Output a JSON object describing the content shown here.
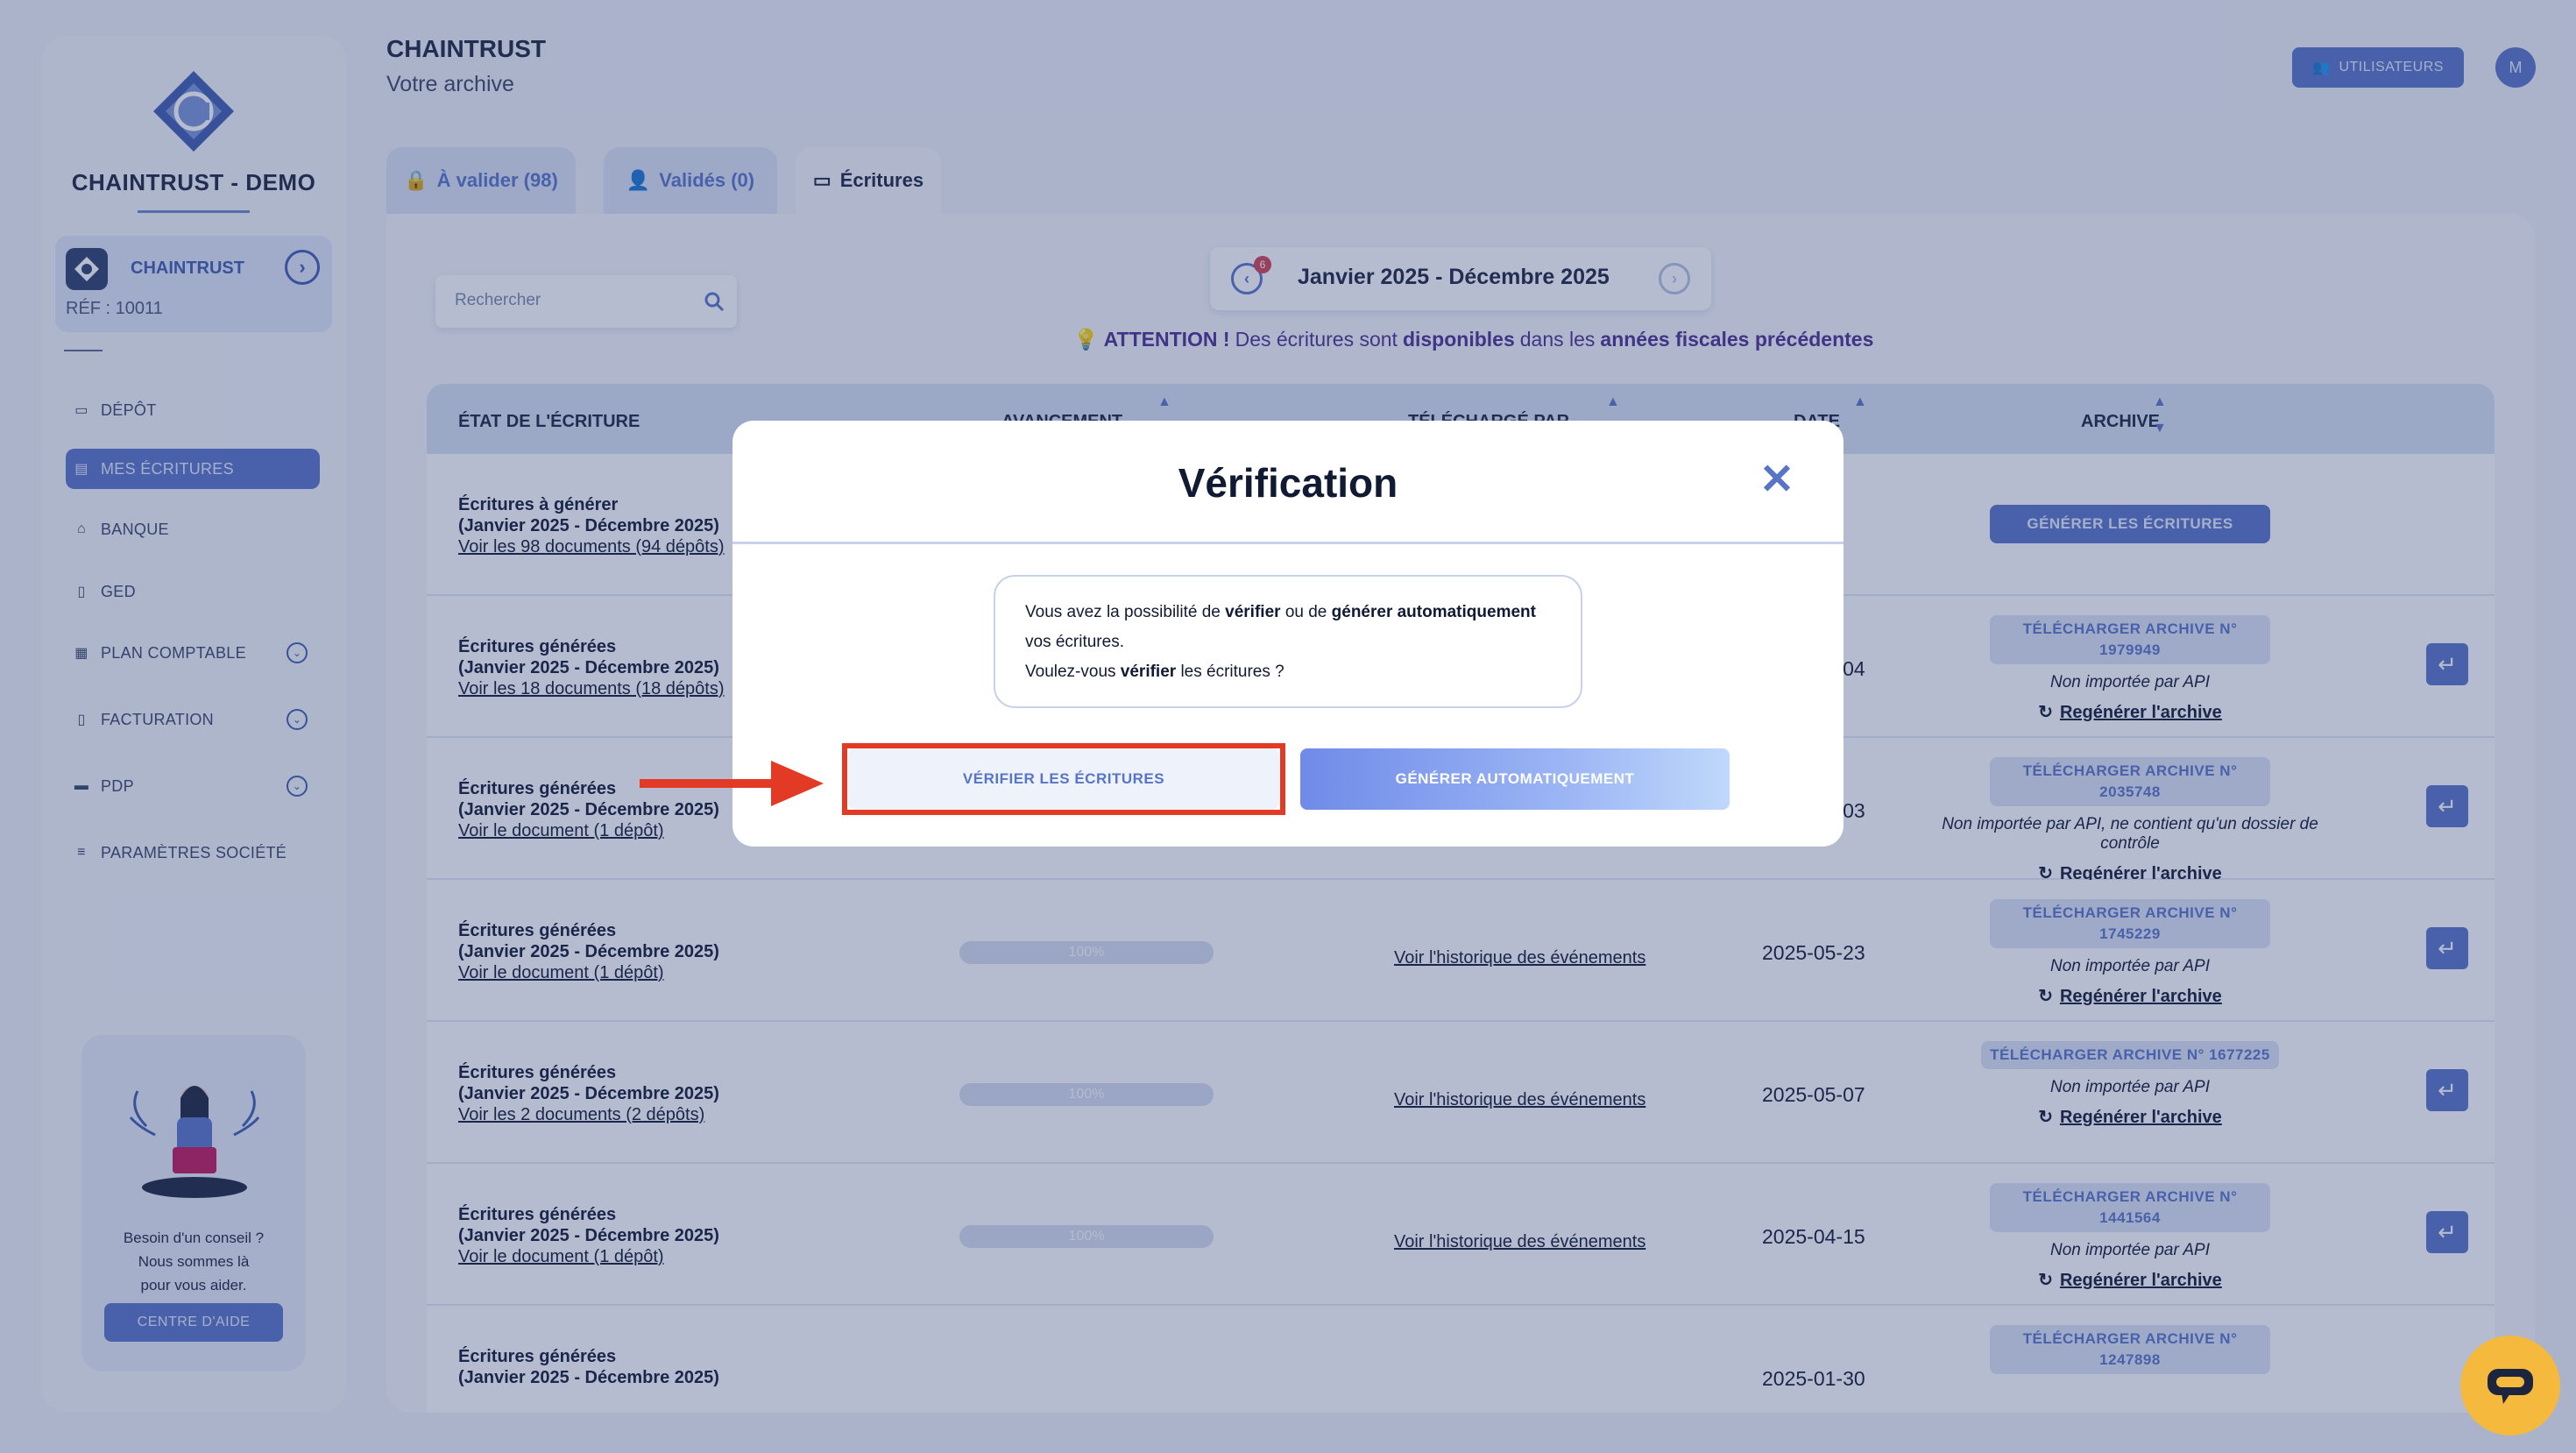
{
  "sidebar": {
    "org_name": "CHAINTRUST - DEMO",
    "company": {
      "name": "CHAINTRUST",
      "ref": "RÉF : 10011"
    },
    "items": [
      {
        "label": "DÉPÔT",
        "icon": "folder-icon"
      },
      {
        "label": "MES ÉCRITURES",
        "icon": "document-icon",
        "active": true
      },
      {
        "label": "BANQUE",
        "icon": "bank-icon"
      },
      {
        "label": "GED",
        "icon": "file-icon"
      },
      {
        "label": "PLAN COMPTABLE",
        "icon": "book-icon",
        "expandable": true
      },
      {
        "label": "FACTURATION",
        "icon": "invoice-icon",
        "expandable": true
      },
      {
        "label": "PDP",
        "icon": "card-icon",
        "expandable": true
      },
      {
        "label": "PARAMÈTRES SOCIÉTÉ",
        "icon": "sliders-icon"
      }
    ],
    "help": {
      "line1": "Besoin d'un conseil ?",
      "line2": "Nous sommes là",
      "line3": "pour vous aider.",
      "button": "CENTRE D'AIDE"
    }
  },
  "header": {
    "title": "CHAINTRUST",
    "subtitle": "Votre archive",
    "users_button": "UTILISATEURS",
    "avatar_initial": "M"
  },
  "tabs": [
    {
      "label": "À valider (98)",
      "icon": "lock-icon"
    },
    {
      "label": "Validés (0)",
      "icon": "users-icon"
    },
    {
      "label": "Écritures",
      "icon": "folder-icon",
      "active": true
    }
  ],
  "search": {
    "placeholder": "Rechercher"
  },
  "period": {
    "label": "Janvier 2025 - Décembre 2025",
    "badge": "6"
  },
  "attention": {
    "prefix": "ATTENTION !",
    "part1": "Des écritures sont",
    "bold1": "disponibles",
    "part2": "dans les",
    "bold2": "années fiscales précédentes"
  },
  "table": {
    "headers": {
      "etat": "ÉTAT DE L'ÉCRITURE",
      "avancement": "AVANCEMENT",
      "telecharge": "TÉLÉCHARGÉ PAR",
      "date": "DATE",
      "archive": "ARCHIVE"
    },
    "rows": [
      {
        "title": "Écritures à générer",
        "period": "(Janvier 2025 - Décembre 2025)",
        "link": "Voir les 98 documents (94 dépôts)",
        "archive_btn": "GÉNÉRER LES ÉCRITURES"
      },
      {
        "title": "Écritures générées",
        "period": "(Janvier 2025 - Décembre 2025)",
        "link": "Voir les 18 documents (18 dépôts)",
        "date": "2025-06-04",
        "archive_btn": "TÉLÉCHARGER ARCHIVE N° 1979949",
        "status": "Non importée par API",
        "regen": "Regénérer l'archive"
      },
      {
        "title": "Écritures générées",
        "period": "(Janvier 2025 - Décembre 2025)",
        "link": "Voir le document (1 dépôt)",
        "date": "2025-06-03",
        "archive_btn": "TÉLÉCHARGER ARCHIVE N° 2035748",
        "status": "Non importée par API, ne contient qu'un dossier de contrôle",
        "regen": "Regénérer l'archive"
      },
      {
        "title": "Écritures générées",
        "period": "(Janvier 2025 - Décembre 2025)",
        "link": "Voir le document (1 dépôt)",
        "progress": "100%",
        "history": "Voir l'historique des événements",
        "date": "2025-05-23",
        "archive_btn": "TÉLÉCHARGER ARCHIVE N° 1745229",
        "status": "Non importée par API",
        "regen": "Regénérer l'archive"
      },
      {
        "title": "Écritures générées",
        "period": "(Janvier 2025 - Décembre 2025)",
        "link": "Voir les 2 documents (2 dépôts)",
        "progress": "100%",
        "history": "Voir l'historique des événements",
        "date": "2025-05-07",
        "archive_btn": "TÉLÉCHARGER ARCHIVE N° 1677225",
        "status": "Non importée par API",
        "regen": "Regénérer l'archive"
      },
      {
        "title": "Écritures générées",
        "period": "(Janvier 2025 - Décembre 2025)",
        "link": "Voir le document (1 dépôt)",
        "progress": "100%",
        "history": "Voir l'historique des événements",
        "date": "2025-04-15",
        "archive_btn": "TÉLÉCHARGER ARCHIVE N° 1441564",
        "status": "Non importée par API",
        "regen": "Regénérer l'archive"
      },
      {
        "title": "Écritures générées",
        "period": "(Janvier 2025 - Décembre 2025)",
        "date": "2025-01-30",
        "archive_btn": "TÉLÉCHARGER ARCHIVE N° 1247898"
      }
    ]
  },
  "modal": {
    "title": "Vérification",
    "msg_a": "Vous avez la possibilité de",
    "msg_b": "vérifier",
    "msg_c": "ou de",
    "msg_d": "générer automatiquement",
    "msg_e": "vos écritures.",
    "msg_f": "Voulez-vous",
    "msg_g": "vérifier",
    "msg_h": "les écritures ?",
    "verify_button": "VÉRIFIER LES ÉCRITURES",
    "auto_button": "GÉNÉRER AUTOMATIQUEMENT"
  },
  "colors": {
    "accent": "#5874c6",
    "highlight": "#e23a24",
    "chat": "#f5b93e"
  }
}
